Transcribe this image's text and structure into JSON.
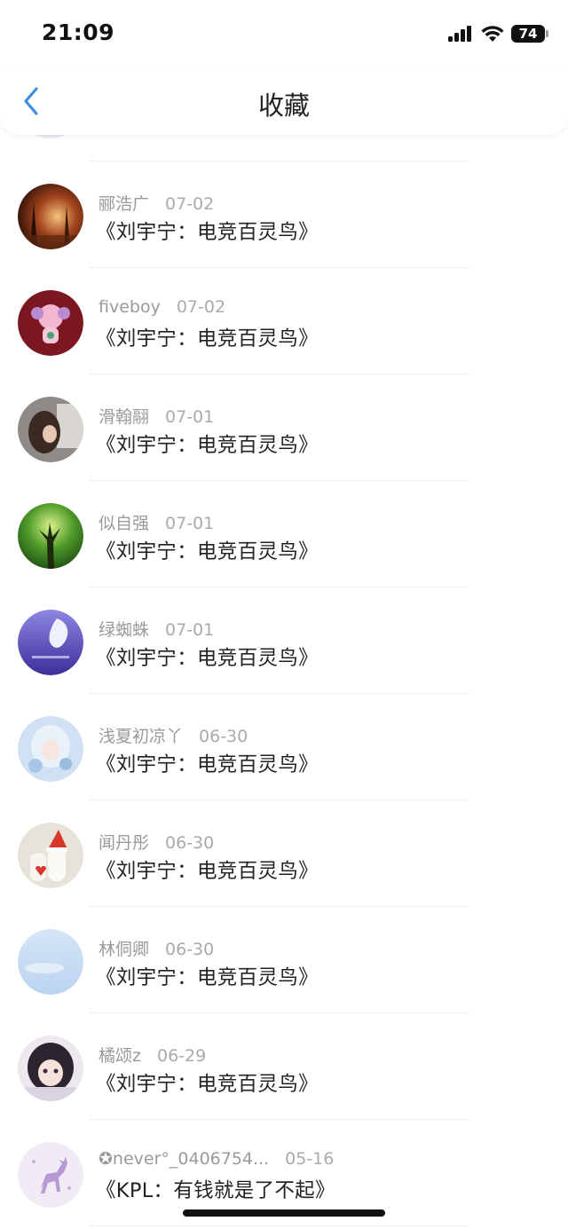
{
  "status_bar": {
    "time": "21:09",
    "battery": "74"
  },
  "nav": {
    "title": "收藏"
  },
  "items": [
    {
      "user": "",
      "date": "",
      "title": ""
    },
    {
      "user": "郦浩广",
      "date": "07-02",
      "title": "《刘宇宁：电竞百灵鸟》"
    },
    {
      "user": "fiveboy",
      "date": "07-02",
      "title": "《刘宇宁：电竞百灵鸟》"
    },
    {
      "user": "滑翰翮",
      "date": "07-01",
      "title": "《刘宇宁：电竞百灵鸟》"
    },
    {
      "user": "似自强",
      "date": "07-01",
      "title": "《刘宇宁：电竞百灵鸟》"
    },
    {
      "user": "绿蜘蛛",
      "date": "07-01",
      "title": "《刘宇宁：电竞百灵鸟》"
    },
    {
      "user": "浅夏初凉丫",
      "date": "06-30",
      "title": "《刘宇宁：电竞百灵鸟》"
    },
    {
      "user": "闻丹彤",
      "date": "06-30",
      "title": "《刘宇宁：电竞百灵鸟》"
    },
    {
      "user": "林侗卿",
      "date": "06-30",
      "title": "《刘宇宁：电竞百灵鸟》"
    },
    {
      "user": "橘颂z",
      "date": "06-29",
      "title": "《刘宇宁：电竞百灵鸟》"
    },
    {
      "user": "✪never°_0406754...",
      "date": "05-16",
      "title": "《KPL：有钱就是了不起》"
    }
  ],
  "avatars": [
    "flower-avatar",
    "autumn-forest-avatar",
    "cartoon-ram-avatar",
    "girl-photo-avatar",
    "green-tree-avatar",
    "purple-figure-avatar",
    "anime-girl-avatar",
    "snowman-hat-avatar",
    "sky-avatar",
    "anime-dark-hair-avatar",
    "deer-avatar"
  ]
}
